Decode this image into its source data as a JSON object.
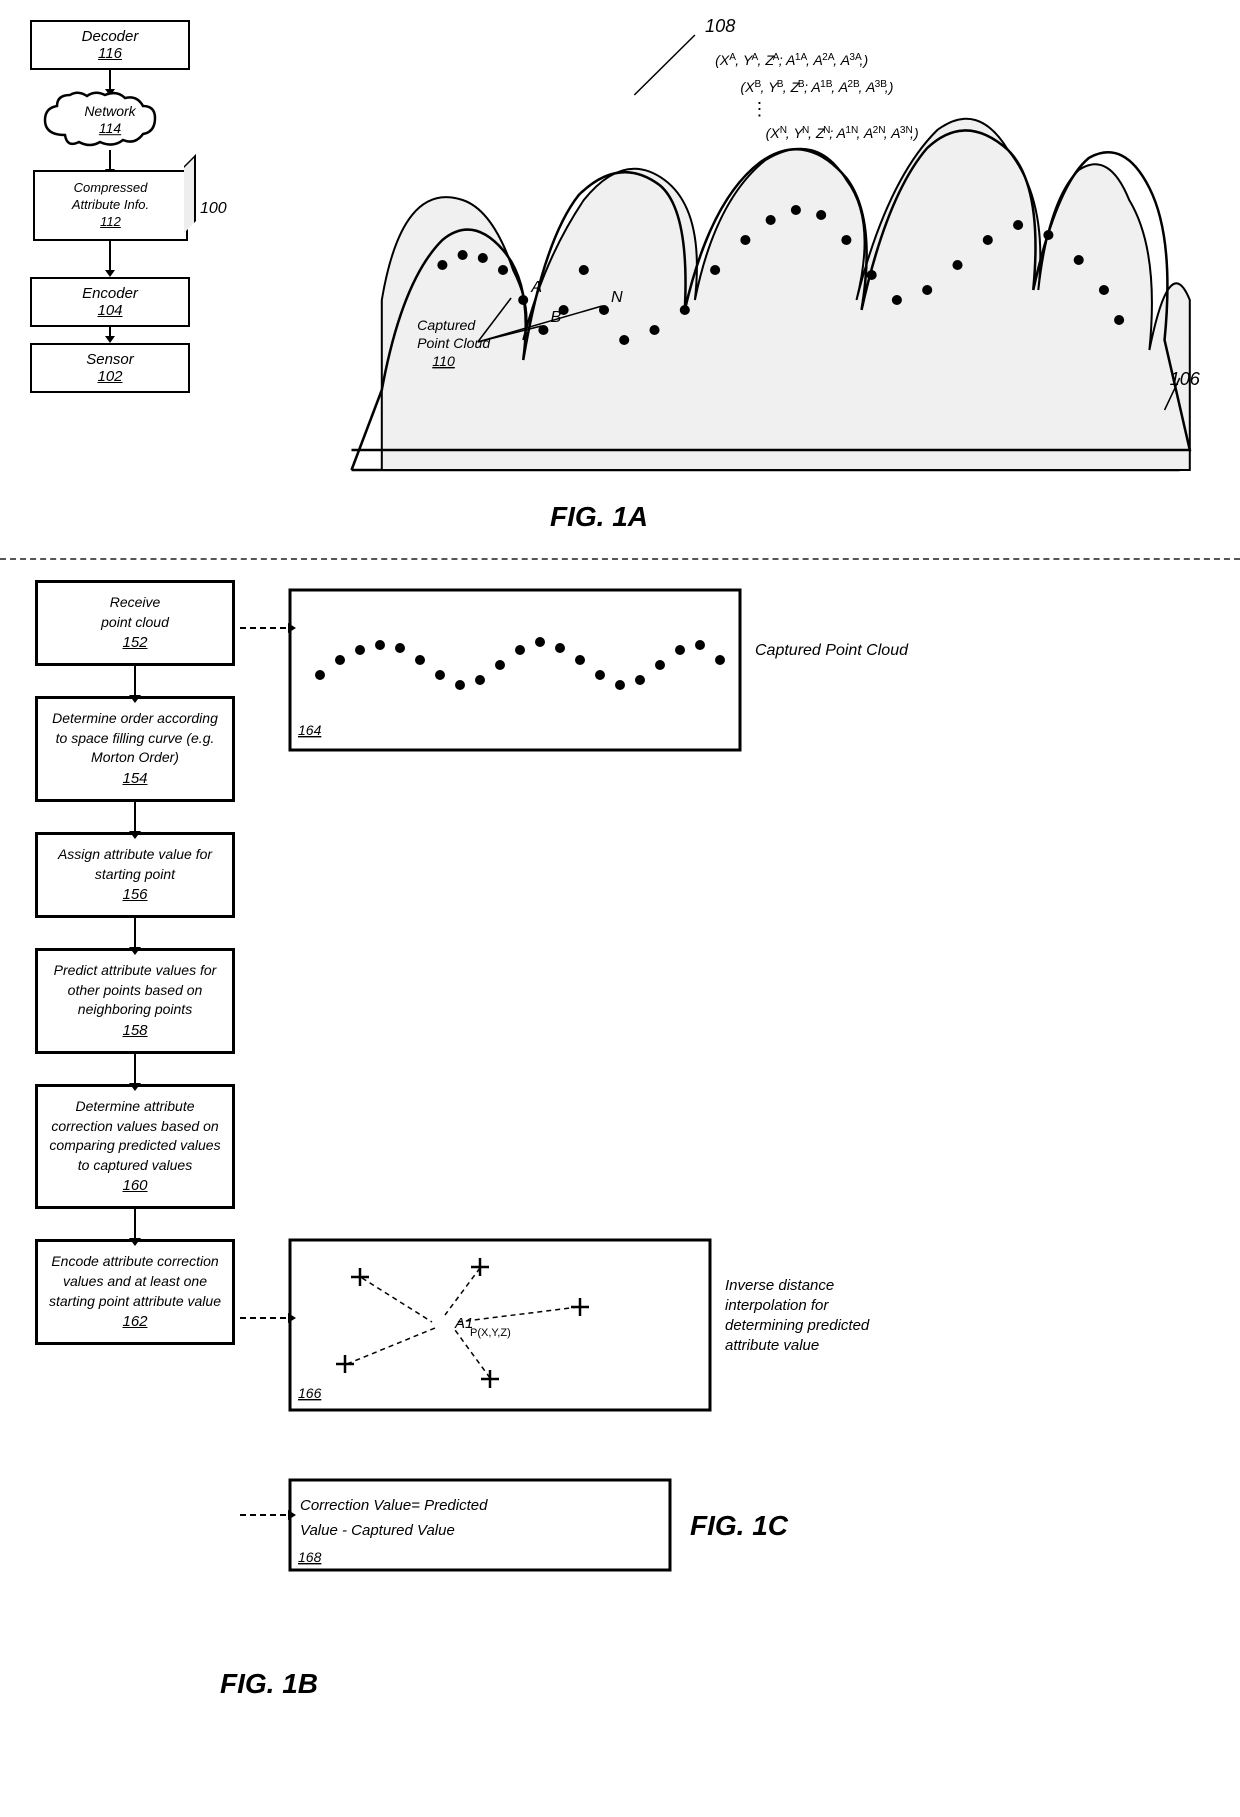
{
  "fig1a": {
    "label": "FIG. 1A",
    "decoder": {
      "label": "Decoder",
      "ref": "116"
    },
    "network": {
      "label": "Network",
      "ref": "114"
    },
    "compressed": {
      "label": "Compressed\nAttribute Info.",
      "ref": "112"
    },
    "capture_label": "100",
    "point_cloud": {
      "label": "Captured\nPoint Cloud",
      "ref": "110"
    },
    "encoder": {
      "label": "Encoder",
      "ref": "104"
    },
    "sensor": {
      "label": "Sensor",
      "ref": "102"
    },
    "ref106": "106",
    "ref108": "108",
    "points_a": "(Xₐ, Yₐ, Zₐ; A₁ₐ, A₂ₐ, A₃ₐ,)",
    "points_b": "(Xʙ, Yʙ, Zʙ; A₁ʙ, A₂ʙ, A₃ʙ,)",
    "points_n": "(Xₙ, Yₙ, Zₙ; A₁ₙ, A₂ₙ, A₃ₙ,)",
    "point_a": "A",
    "point_b": "B",
    "point_n": "N"
  },
  "fig1b": {
    "label": "FIG. 1B",
    "steps": [
      {
        "id": "step1",
        "text": "Receive\npoint cloud",
        "ref": "152"
      },
      {
        "id": "step2",
        "text": "Determine order according\nto space filling curve (e.g.\nMorton Order)",
        "ref": "154"
      },
      {
        "id": "step3",
        "text": "Assign attribute value for\nstarting point",
        "ref": "156"
      },
      {
        "id": "step4",
        "text": "Predict attribute values for\nother points based on\nneighboring points",
        "ref": "158"
      },
      {
        "id": "step5",
        "text": "Determine attribute\ncorrection values based on\ncomparing predicted values\nto captured values",
        "ref": "160"
      },
      {
        "id": "step6",
        "text": "Encode attribute correction\nvalues and at least one\nstarting point attribute value",
        "ref": "162"
      }
    ]
  },
  "fig1c": {
    "label": "FIG. 1C",
    "captured_cloud_label": "Captured Point Cloud",
    "cloud_ref": "164",
    "interp_label": "Inverse distance\ninterpolation for\ndetermining predicted\nattribute value",
    "interp_ref": "166",
    "interp_point": "A1ₚ(ˣ,ʸ,ᴴ)",
    "correction_ref": "168",
    "correction_text": "Correction Value= Predicted\nValue - Captured Value"
  }
}
